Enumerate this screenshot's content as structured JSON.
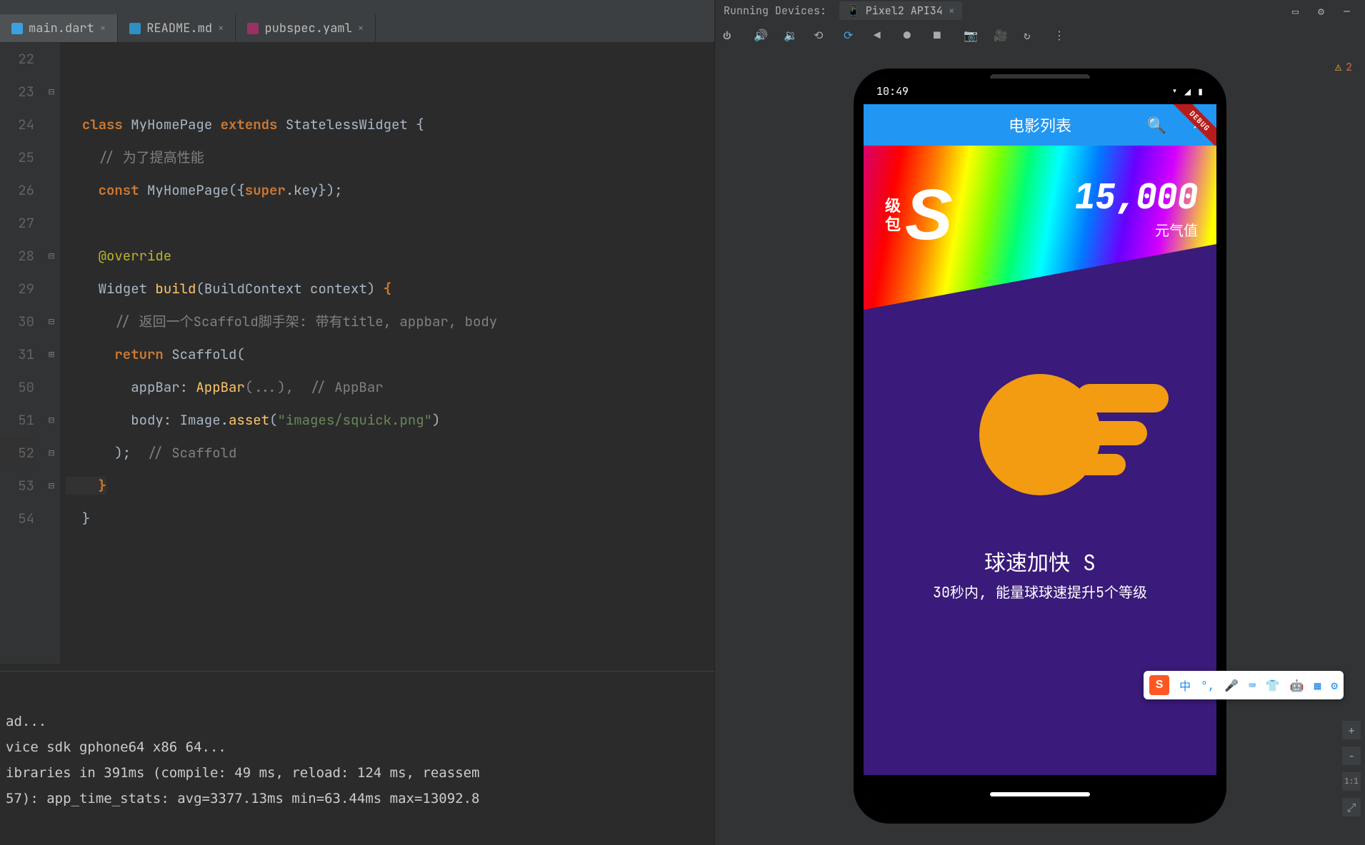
{
  "topbar": {
    "device_label": "Pixel2 API 34 (mobi…"
  },
  "tabs": [
    {
      "name": "main.dart",
      "active": true,
      "icon": "dart"
    },
    {
      "name": "README.md",
      "active": false,
      "icon": "md"
    },
    {
      "name": "pubspec.yaml",
      "active": false,
      "icon": "yaml"
    }
  ],
  "gutter": [
    "22",
    "23",
    "24",
    "25",
    "26",
    "27",
    "28",
    "29",
    "30",
    "31",
    "50",
    "51",
    "52",
    "53",
    "54"
  ],
  "gutter_marks": {
    "23": "⊟",
    "28": "◎↑",
    "28b": "⊟",
    "30": "⊟",
    "31": "⊞",
    "51": "⊟",
    "52": "⊟",
    "53": "⊟"
  },
  "code": {
    "l23a": "class ",
    "l23b": "MyHomePage ",
    "l23c": "extends ",
    "l23d": "StatelessWidget {",
    "l24": "// 为了提高性能",
    "l25a": "const ",
    "l25b": "MyHomePage({",
    "l25c": "super",
    "l25d": ".key});",
    "l27": "@override",
    "l28a": "Widget ",
    "l28b": "build",
    "l28c": "(BuildContext context) ",
    "l28d": "{",
    "l29": "// 返回一个Scaffold脚手架: 带有title, appbar, body",
    "l30a": "return ",
    "l30b": "Scaffold(",
    "l31a": "appBar: ",
    "l31b": "AppBar",
    "l31c": "(...),  ",
    "l31d": "// AppBar",
    "l50a": "body: Image.",
    "l50b": "asset",
    "l50c": "(",
    "l50d": "\"images/squick.png\"",
    "l50e": ")",
    "l51a": ");  ",
    "l51b": "// Scaffold",
    "l52": "}",
    "l53": "}"
  },
  "console": {
    "l1": "ad...",
    "l2": "vice sdk gphone64 x86 64...",
    "l3": "ibraries in 391ms (compile: 49 ms, reload: 124 ms, reassem",
    "l4": "57): app_time_stats: avg=3377.13ms min=63.44ms max=13092.8"
  },
  "running": {
    "label": "Running Devices:",
    "device": "Pixel2 API34"
  },
  "phone": {
    "clock": "10:49",
    "appbar_title": "电影列表",
    "grade_cn1": "级",
    "grade_cn2": "包",
    "grade_letter": "S",
    "points_value": "15,000",
    "points_unit": "元气值",
    "skill_title": "球速加快 S",
    "skill_desc": "30秒内, 能量球球速提升5个等级"
  },
  "ime": {
    "logo": "S",
    "lang": "中"
  },
  "zoom": {
    "plus": "+",
    "minus": "−",
    "ratio": "1:1",
    "fit": "⤢"
  },
  "errs": {
    "count": "2"
  }
}
